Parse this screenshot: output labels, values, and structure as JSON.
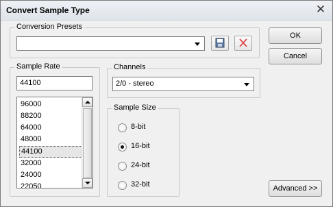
{
  "window": {
    "title": "Convert Sample Type"
  },
  "conversion_presets": {
    "label": "Conversion Presets",
    "value": "",
    "save_icon": "floppy-disk-icon",
    "delete_icon": "red-x-icon"
  },
  "buttons": {
    "ok": "OK",
    "cancel": "Cancel",
    "advanced": "Advanced >>"
  },
  "sample_rate": {
    "label": "Sample Rate",
    "value": "44100",
    "options": [
      "96000",
      "88200",
      "64000",
      "48000",
      "44100",
      "32000",
      "24000",
      "22050"
    ],
    "selected": "44100"
  },
  "channels": {
    "label": "Channels",
    "value": "2/0 - stereo"
  },
  "sample_size": {
    "label": "Sample Size",
    "options": [
      "8-bit",
      "16-bit",
      "24-bit",
      "32-bit"
    ],
    "selected": "16-bit"
  },
  "colors": {
    "title_bar": "#e6eaf0",
    "dialog_bg": "#f0f0f0",
    "delete_icon": "#e05050"
  }
}
